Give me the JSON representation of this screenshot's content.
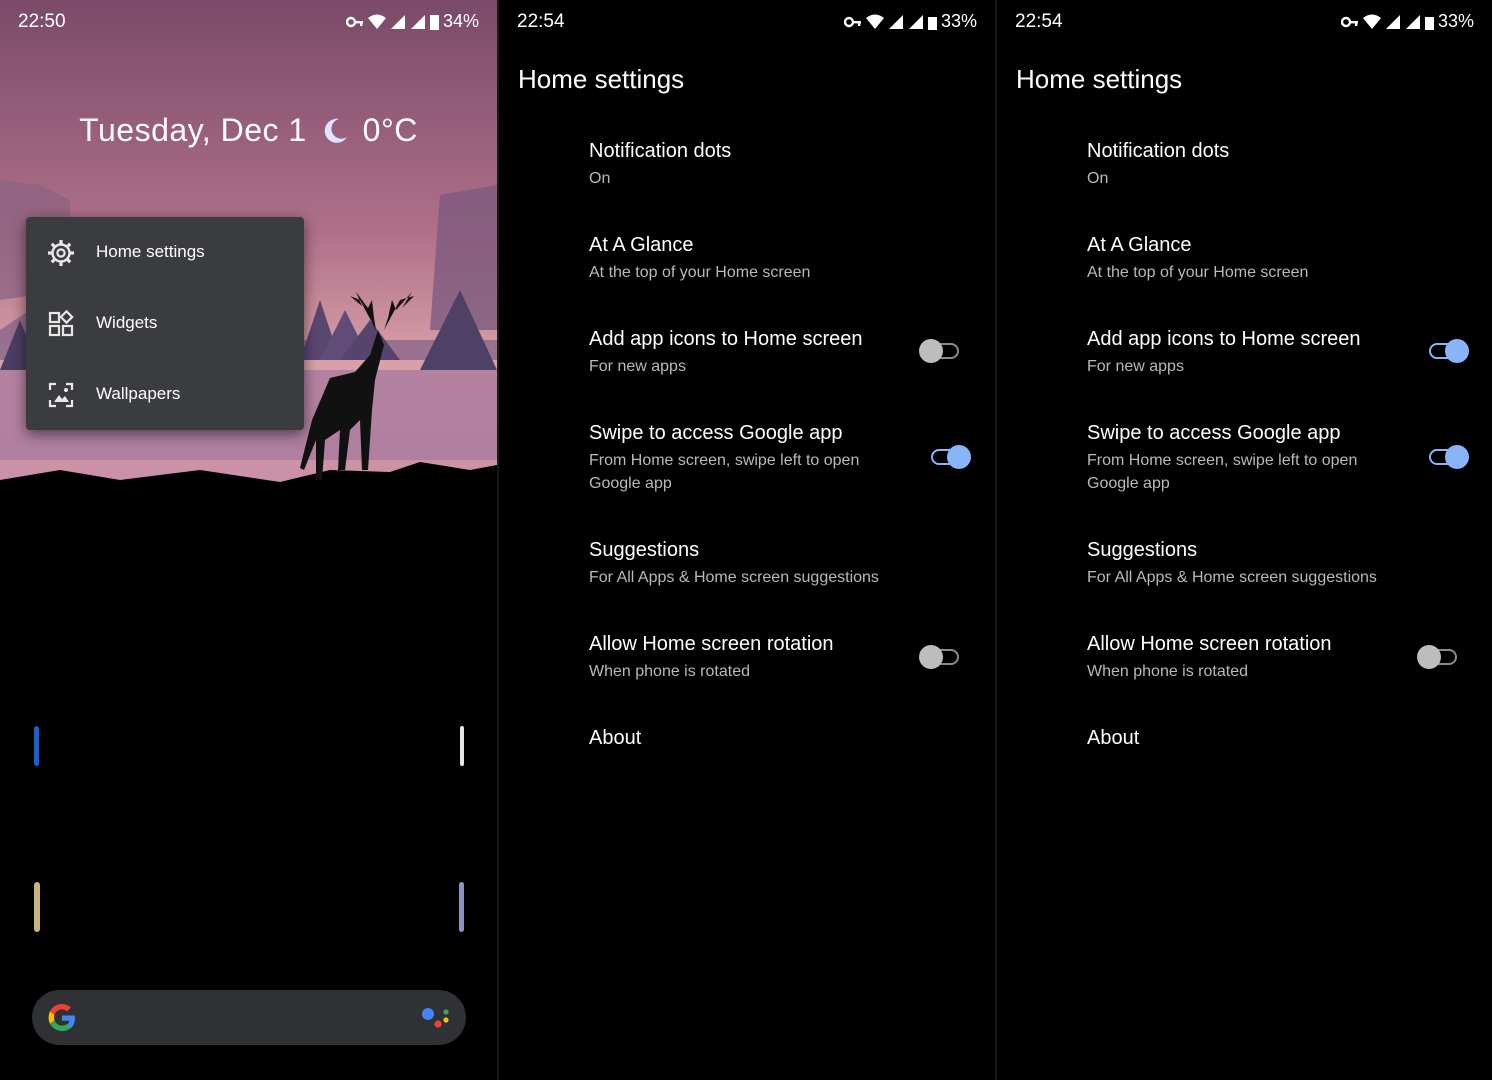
{
  "panels": {
    "home": {
      "status": {
        "time": "22:50",
        "battery": "34%"
      },
      "date_text": "Tuesday, Dec 1",
      "weather": "0°C",
      "context_menu": {
        "items": [
          {
            "label": "Home settings",
            "icon": "gear-icon"
          },
          {
            "label": "Widgets",
            "icon": "widgets-icon"
          },
          {
            "label": "Wallpapers",
            "icon": "wallpaper-icon"
          }
        ]
      },
      "search_bar": {
        "left_icon": "google-g-icon",
        "right_icon": "assistant-icon"
      }
    },
    "settings_a": {
      "status": {
        "time": "22:54",
        "battery": "33%"
      },
      "title": "Home settings",
      "items": [
        {
          "title": "Notification dots",
          "subtitle": "On"
        },
        {
          "title": "At A Glance",
          "subtitle": "At the top of your Home screen"
        },
        {
          "title": "Add app icons to Home screen",
          "subtitle": "For new apps",
          "toggle": "off"
        },
        {
          "title": "Swipe to access Google app",
          "subtitle_line1": "From Home screen, swipe left to open",
          "subtitle_line2": "Google app",
          "toggle": "on"
        },
        {
          "title": "Suggestions",
          "subtitle": "For All Apps & Home screen suggestions"
        },
        {
          "title": "Allow Home screen rotation",
          "subtitle": "When phone is rotated",
          "toggle": "off"
        },
        {
          "title": "About"
        }
      ]
    },
    "settings_b": {
      "status": {
        "time": "22:54",
        "battery": "33%"
      },
      "title": "Home settings",
      "items": [
        {
          "title": "Notification dots",
          "subtitle": "On"
        },
        {
          "title": "At A Glance",
          "subtitle": "At the top of your Home screen"
        },
        {
          "title": "Add app icons to Home screen",
          "subtitle": "For new apps",
          "toggle": "on"
        },
        {
          "title": "Swipe to access Google app",
          "subtitle_line1": "From Home screen, swipe left to open",
          "subtitle_line2": "Google app",
          "toggle": "on"
        },
        {
          "title": "Suggestions",
          "subtitle": "For All Apps & Home screen suggestions"
        },
        {
          "title": "Allow Home screen rotation",
          "subtitle": "When phone is rotated",
          "toggle": "off"
        },
        {
          "title": "About"
        }
      ]
    }
  },
  "colors": {
    "accent": "#8ab4f8",
    "menu_bg": "#3b3c3f",
    "search_bg": "#303134",
    "subtitle": "#b9b9b9"
  }
}
